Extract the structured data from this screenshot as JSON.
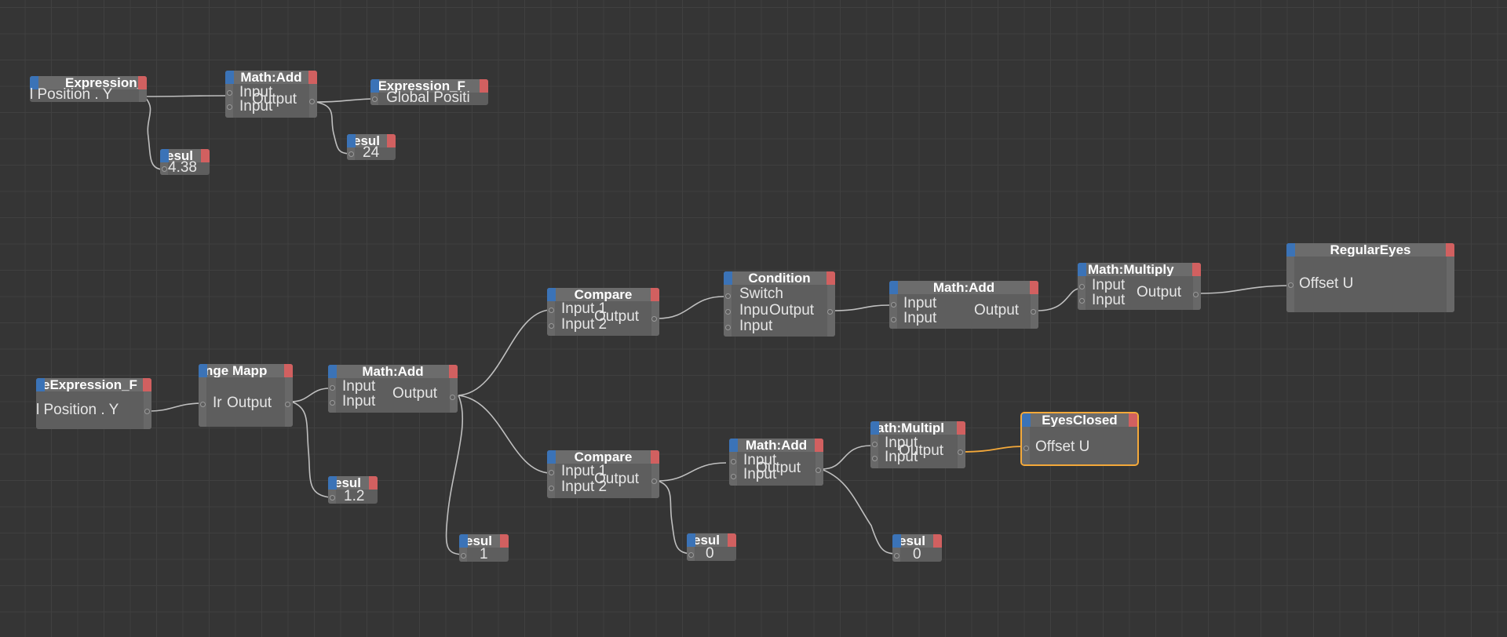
{
  "nodes": {
    "n1": {
      "title": "Expression_C",
      "labels": [
        "l Position . Y"
      ]
    },
    "n2": {
      "title": "Math:Add",
      "labels": [
        "Input",
        "Input",
        "Output"
      ]
    },
    "n3": {
      "title": "eExpression_F",
      "labels": [
        "Global Positi"
      ]
    },
    "n4": {
      "title": "esul",
      "labels": [
        "4.38"
      ]
    },
    "n5": {
      "title": "esul",
      "labels": [
        "24"
      ]
    },
    "n6": {
      "title": "eExpression_F",
      "labels": [
        "l Position . Y"
      ]
    },
    "n7": {
      "title": "nge Mapp",
      "labels": [
        "Ir",
        "Output"
      ]
    },
    "n8": {
      "title": "Math:Add",
      "labels": [
        "Input",
        "Input",
        "Output"
      ]
    },
    "n9": {
      "title": "esul",
      "labels": [
        "1.2"
      ]
    },
    "n10": {
      "title": "esul",
      "labels": [
        "1"
      ]
    },
    "n11": {
      "title": "Compare",
      "labels": [
        "Input 1",
        "Input 2",
        "Output"
      ]
    },
    "n12": {
      "title": "Condition",
      "labels": [
        "Switch",
        "Inpu",
        "Input",
        "Output"
      ]
    },
    "n13": {
      "title": "Math:Add",
      "labels": [
        "Input",
        "Input",
        "Output"
      ]
    },
    "n14": {
      "title": "Math:Multiply",
      "labels": [
        "Input",
        "Input",
        "Output"
      ]
    },
    "n15": {
      "title": "RegularEyes",
      "labels": [
        "Offset U"
      ]
    },
    "n16": {
      "title": "Compare",
      "labels": [
        "Input 1",
        "Input 2",
        "Output"
      ]
    },
    "n17": {
      "title": "esul",
      "labels": [
        "0"
      ]
    },
    "n18": {
      "title": "Math:Add",
      "labels": [
        "Input",
        "Input",
        "Output"
      ]
    },
    "n19": {
      "title": "ath:Multipl",
      "labels": [
        "Input",
        "Input",
        "Output"
      ]
    },
    "n20": {
      "title": "esul",
      "labels": [
        "0"
      ]
    },
    "n21": {
      "title": "EyesClosed",
      "labels": [
        "Offset U"
      ]
    }
  },
  "colors": {
    "background": "#353535",
    "grid": "#404040",
    "node_body": "#5e5e5e",
    "node_header": "#6c6c6c",
    "pin_left": "#3b73b7",
    "pin_right": "#d16060",
    "wire": "#bfbfbf",
    "selected_wire": "#f4a93a"
  }
}
